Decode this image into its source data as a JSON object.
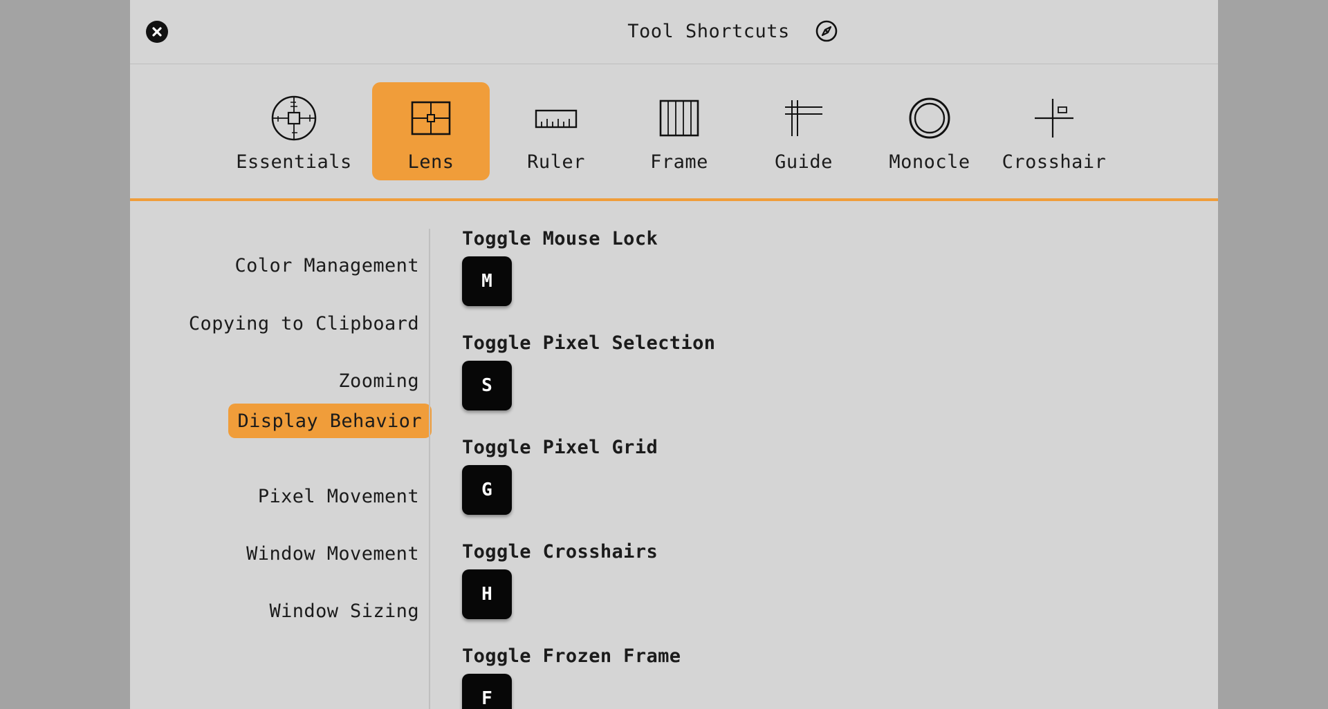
{
  "window": {
    "title": "Tool Shortcuts",
    "close_icon": "close-icon",
    "compass_icon": "compass-icon"
  },
  "toolbar": {
    "accent_color": "#f09d3a",
    "tools": [
      {
        "label": "Essentials",
        "icon": "essentials-icon",
        "active": false
      },
      {
        "label": "Lens",
        "icon": "lens-icon",
        "active": true
      },
      {
        "label": "Ruler",
        "icon": "ruler-icon",
        "active": false
      },
      {
        "label": "Frame",
        "icon": "frame-icon",
        "active": false
      },
      {
        "label": "Guide",
        "icon": "guide-icon",
        "active": false
      },
      {
        "label": "Monocle",
        "icon": "monocle-icon",
        "active": false
      },
      {
        "label": "Crosshair",
        "icon": "crosshair-icon",
        "active": false
      }
    ]
  },
  "sidebar": {
    "items": [
      {
        "label": "Color Management",
        "active": false
      },
      {
        "label": "Copying to Clipboard",
        "active": false
      },
      {
        "label": "Zooming",
        "active": false
      },
      {
        "label": "Display Behavior",
        "active": true
      },
      {
        "label": "Pixel Movement",
        "active": false
      },
      {
        "label": "Window Movement",
        "active": false
      },
      {
        "label": "Window Sizing",
        "active": false
      }
    ]
  },
  "shortcuts": [
    {
      "label": "Toggle Mouse Lock",
      "key": "M"
    },
    {
      "label": "Toggle Pixel Selection",
      "key": "S"
    },
    {
      "label": "Toggle Pixel Grid",
      "key": "G"
    },
    {
      "label": "Toggle Crosshairs",
      "key": "H"
    },
    {
      "label": "Toggle Frozen Frame",
      "key": "F"
    }
  ]
}
